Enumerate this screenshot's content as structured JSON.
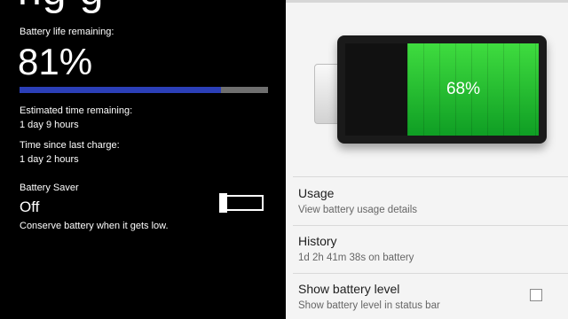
{
  "left": {
    "title_fragment": "ng g",
    "life_label": "Battery life remaining:",
    "percent_text": "81%",
    "level_fraction": 0.81,
    "est_label": "Estimated time remaining:",
    "est_value": "1 day 9 hours",
    "since_label": "Time since last charge:",
    "since_value": "1 day 2 hours",
    "saver_label": "Battery Saver",
    "saver_state": "Off",
    "saver_desc": "Conserve battery when it gets low.",
    "colors": {
      "bar": "#2b3fb8",
      "track": "#6f6f6f"
    }
  },
  "right": {
    "battery_percent_text": "68%",
    "battery_level_fraction": 0.68,
    "items": [
      {
        "title": "Usage",
        "subtitle": "View battery usage details"
      },
      {
        "title": "History",
        "subtitle": "1d 2h 41m 38s on battery"
      },
      {
        "title": "Show battery level",
        "subtitle": "Show battery level in status bar",
        "checked": false
      }
    ],
    "colors": {
      "fill": "#22c43a"
    }
  }
}
